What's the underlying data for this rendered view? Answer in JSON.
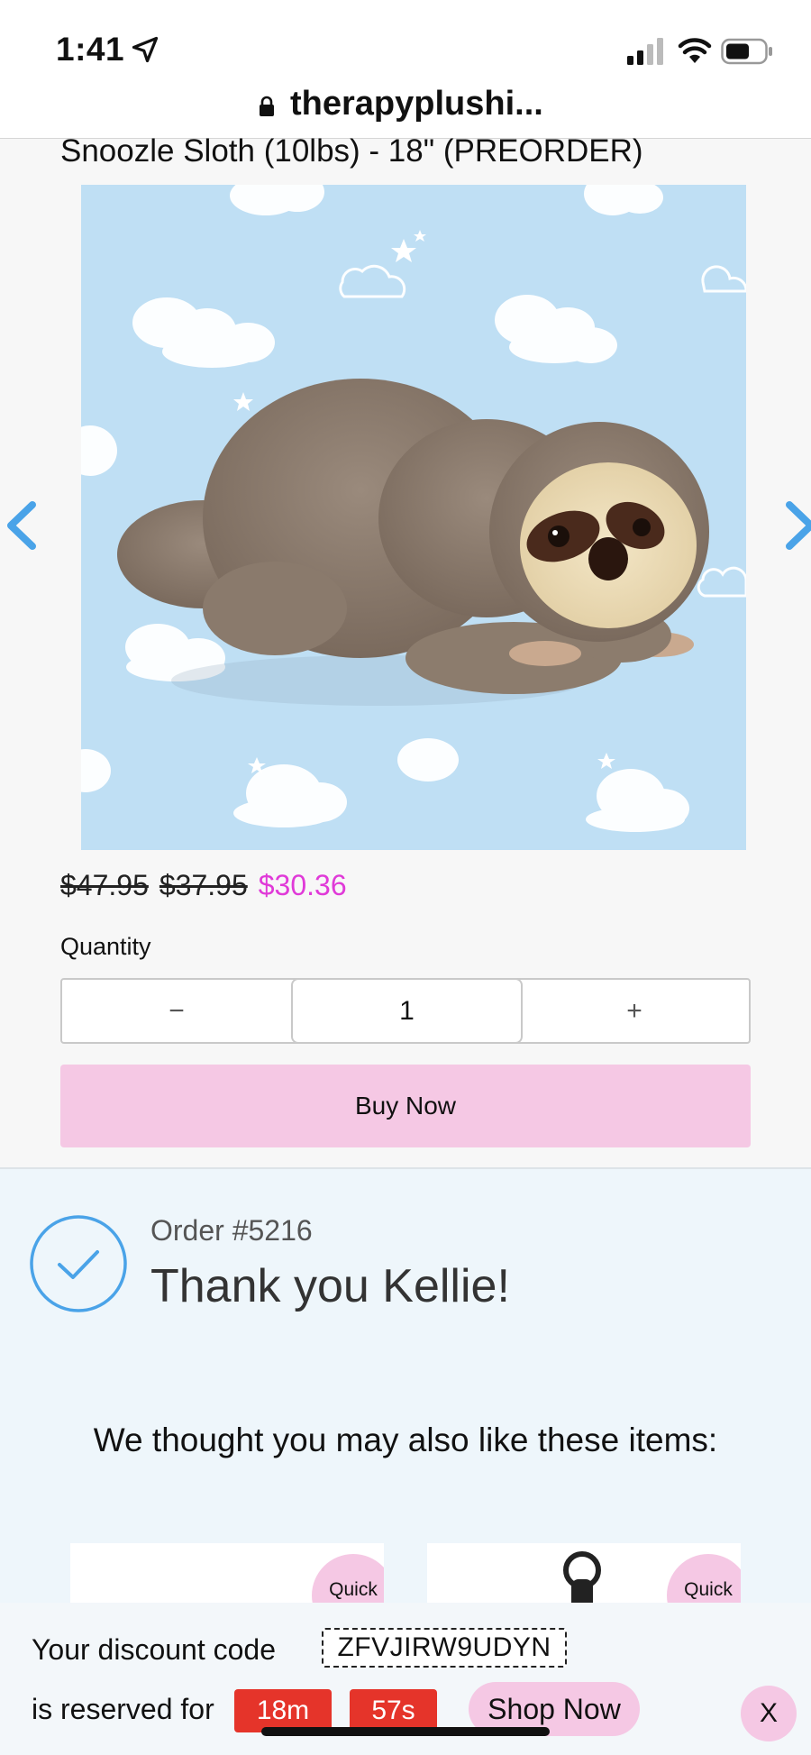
{
  "status_bar": {
    "time": "1:41"
  },
  "browser": {
    "url": "therapyplushi..."
  },
  "product": {
    "title": "Snoozle Sloth (10lbs) - 18\" (PREORDER)",
    "image_alt": "Sloth plush on cloud background",
    "prices": {
      "original": "$47.95",
      "previous": "$37.95",
      "current": "$30.36"
    },
    "quantity_label": "Quantity",
    "quantity_minus": "−",
    "quantity_value": "1",
    "quantity_plus": "+",
    "buy_now_label": "Buy Now"
  },
  "thank_you": {
    "order_number": "Order #5216",
    "heading": "Thank you Kellie!",
    "recommendations_heading": "We thought you may also like these items:",
    "quick_view_label": "Quick View"
  },
  "discount": {
    "code_label": "Your discount code",
    "code": "ZFVJIRW9UDYN",
    "reserved_label": "is reserved for",
    "minutes": "18m",
    "seconds": "57s",
    "shop_now_label": "Shop Now",
    "close_label": "X"
  },
  "colors": {
    "accent_pink": "#f5c8e4",
    "sale_price": "#e03ad8",
    "timer_red": "#e5342a",
    "nav_blue": "#4aa3e8"
  }
}
